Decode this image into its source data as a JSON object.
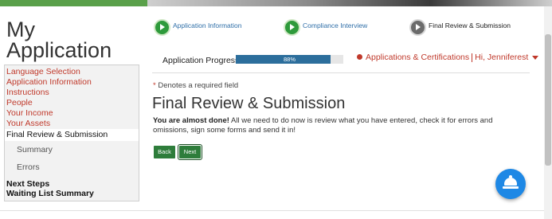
{
  "app": {
    "title_line1": "My",
    "title_line2": "Application"
  },
  "sidebar": {
    "links": [
      "Language Selection",
      "Application Information",
      "Instructions",
      "People",
      "Your Income",
      "Your Assets"
    ],
    "current": "Final Review & Submission",
    "sub_items": [
      "Summary",
      "Errors"
    ],
    "after": [
      "Next Steps",
      "Waiting List Summary"
    ]
  },
  "steps": [
    {
      "label": "Application Information",
      "state": "done"
    },
    {
      "label": "Compliance Interview",
      "state": "done"
    },
    {
      "label": "Final Review & Submission",
      "state": "current"
    }
  ],
  "progress": {
    "label": "Application Progress",
    "value_text": "88%",
    "value": 88
  },
  "header_links": {
    "applications": "Applications & Certifications",
    "user": "Hi, Jenniferest"
  },
  "content": {
    "required_marker": "*",
    "required_note": " Denotes a required field",
    "heading": "Final Review & Submission",
    "intro_bold": "You are almost done!",
    "intro_rest": " All we need to do now is review what you have entered, check it for errors and omissions, sign some forms and send it in!"
  },
  "buttons": {
    "back": "Back",
    "next": "Next"
  },
  "colors": {
    "accent_red": "#c0392b",
    "button_green": "#2e7d3b",
    "progress_blue": "#2c6e9c",
    "fab_blue": "#1e88e5"
  },
  "icons": {
    "step": "chevron-right-icon",
    "fab": "service-bell-icon",
    "dropdown": "caret-down-icon"
  }
}
